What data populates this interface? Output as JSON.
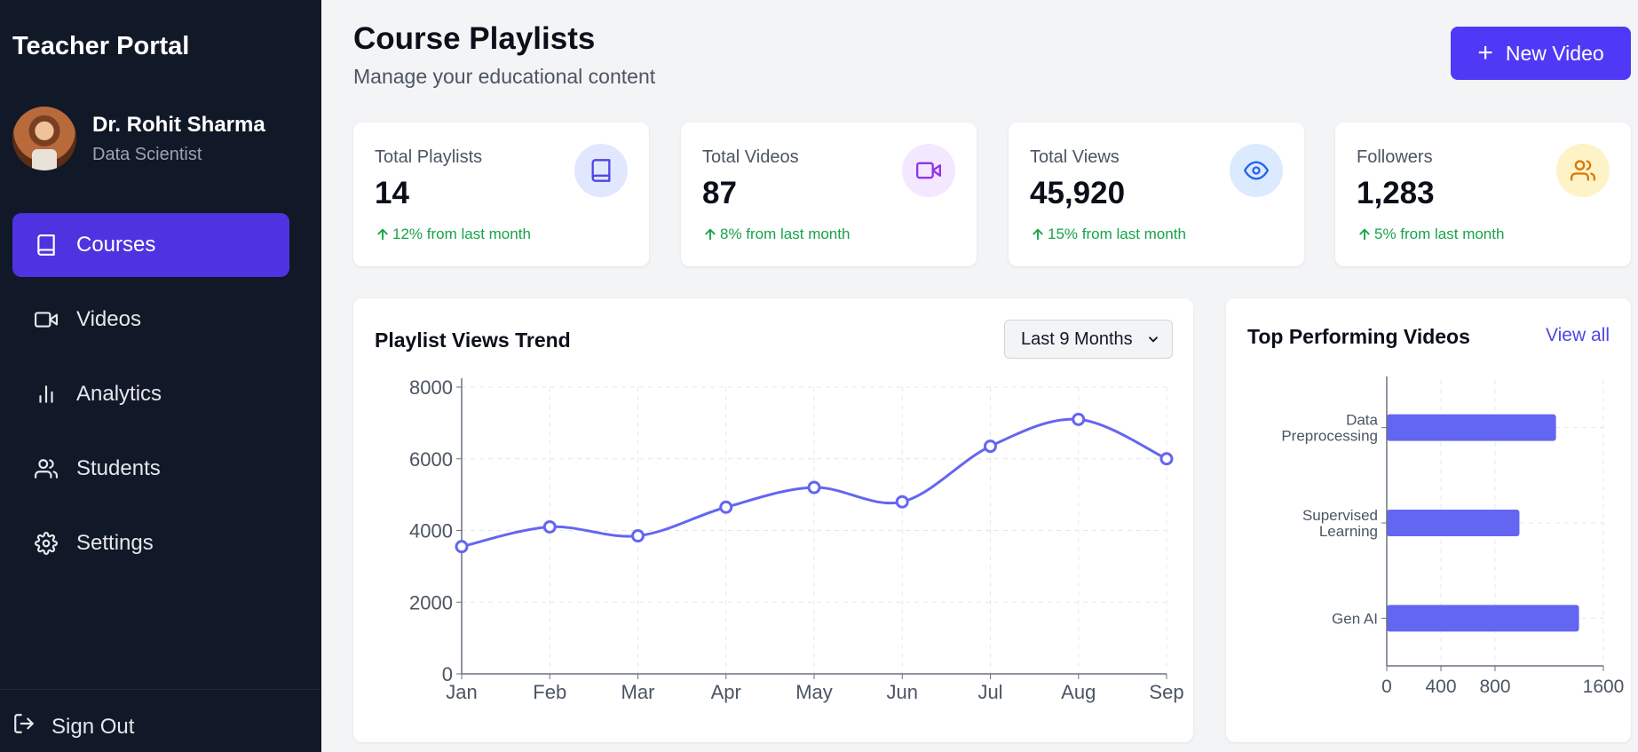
{
  "sidebar": {
    "brand": "Teacher Portal",
    "profile": {
      "name": "Dr. Rohit Sharma",
      "role": "Data Scientist"
    },
    "items": [
      {
        "label": "Courses",
        "icon": "book-icon",
        "active": true
      },
      {
        "label": "Videos",
        "icon": "video-icon",
        "active": false
      },
      {
        "label": "Analytics",
        "icon": "bar-chart-icon",
        "active": false
      },
      {
        "label": "Students",
        "icon": "users-icon",
        "active": false
      },
      {
        "label": "Settings",
        "icon": "gear-icon",
        "active": false
      }
    ],
    "sign_out": "Sign Out"
  },
  "header": {
    "title": "Course Playlists",
    "subtitle": "Manage your educational content",
    "new_video_label": "New Video"
  },
  "stats": [
    {
      "label": "Total Playlists",
      "value": "14",
      "change": "12% from last month",
      "icon": "book-icon",
      "icon_color": "#4f46e5",
      "icon_bg": "#e0e7ff"
    },
    {
      "label": "Total Videos",
      "value": "87",
      "change": "8% from last month",
      "icon": "video-icon",
      "icon_color": "#9333ea",
      "icon_bg": "#f3e8ff"
    },
    {
      "label": "Total Views",
      "value": "45,920",
      "change": "15% from last month",
      "icon": "eye-icon",
      "icon_color": "#2563eb",
      "icon_bg": "#dbeafe"
    },
    {
      "label": "Followers",
      "value": "1,283",
      "change": "5% from last month",
      "icon": "users-icon",
      "icon_color": "#d97706",
      "icon_bg": "#fef3c7"
    }
  ],
  "trend": {
    "title": "Playlist Views Trend",
    "range_selected": "Last 9 Months"
  },
  "top_videos": {
    "title": "Top Performing Videos",
    "view_all": "View all"
  },
  "colors": {
    "accent": "#4f39f6",
    "series": "#6366f1",
    "positive": "#16a34a"
  },
  "chart_data": [
    {
      "type": "line",
      "title": "Playlist Views Trend",
      "x": [
        "Jan",
        "Feb",
        "Mar",
        "Apr",
        "May",
        "Jun",
        "Jul",
        "Aug",
        "Sep"
      ],
      "series": [
        {
          "values": [
            3550,
            4100,
            3850,
            4650,
            5200,
            4800,
            6350,
            7100,
            6000
          ]
        }
      ],
      "ylim": [
        0,
        8000
      ],
      "yticks": [
        "0",
        "2000",
        "4000",
        "6000",
        "8000"
      ],
      "grid": true,
      "smooth": true
    },
    {
      "type": "bar",
      "orientation": "horizontal",
      "title": "Top Performing Videos",
      "categories": [
        "Data Preprocessing",
        "Supervised Learning",
        "Gen AI"
      ],
      "category_lines": [
        [
          "Data",
          "Preprocessing"
        ],
        [
          "Supervised",
          "Learning"
        ],
        [
          "Gen AI"
        ]
      ],
      "values": [
        1250,
        980,
        1420
      ],
      "xlim": [
        0,
        1600
      ],
      "xticks": [
        "0",
        "400",
        "800",
        "1600"
      ],
      "grid": true
    }
  ]
}
